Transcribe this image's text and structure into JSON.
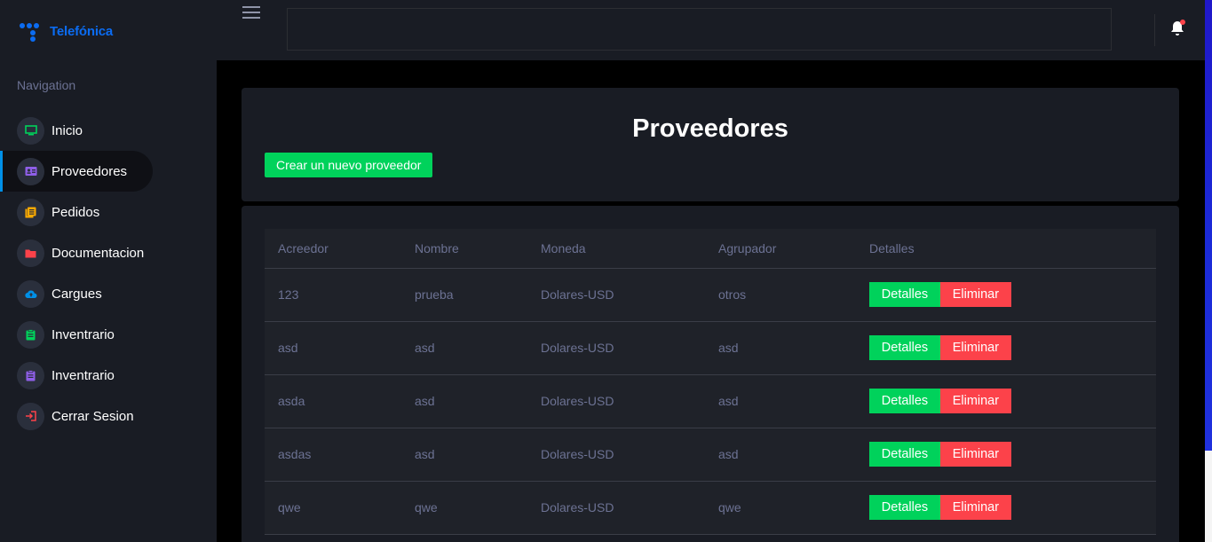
{
  "brand": {
    "name": "Telefónica",
    "color": "#0b6cf2"
  },
  "sidebar": {
    "caption": "Navigation",
    "items": [
      {
        "label": "Inicio",
        "icon": "monitor-icon",
        "color": "#00d25b"
      },
      {
        "label": "Proveedores",
        "icon": "id-card-icon",
        "color": "#8f5fe8",
        "active": true
      },
      {
        "label": "Pedidos",
        "icon": "documents-icon",
        "color": "#ffab00"
      },
      {
        "label": "Documentacion",
        "icon": "folder-icon",
        "color": "#fc424a"
      },
      {
        "label": "Cargues",
        "icon": "cloud-upload-icon",
        "color": "#0090e7"
      },
      {
        "label": "Inventrario",
        "icon": "clipboard-icon",
        "color": "#00d25b"
      },
      {
        "label": "Inventrario",
        "icon": "clipboard-icon",
        "color": "#8f5fe8"
      },
      {
        "label": "Cerrar Sesion",
        "icon": "logout-icon",
        "color": "#fc424a"
      }
    ]
  },
  "header": {
    "search_value": "",
    "notification_icon": "bell-icon"
  },
  "page": {
    "title": "Proveedores",
    "create_button": "Crear un nuevo proveedor"
  },
  "table": {
    "columns": [
      "Acreedor",
      "Nombre",
      "Moneda",
      "Agrupador",
      "Detalles"
    ],
    "rows": [
      {
        "acreedor": "123",
        "nombre": "prueba",
        "moneda": "Dolares-USD",
        "agrupador": "otros"
      },
      {
        "acreedor": "asd",
        "nombre": "asd",
        "moneda": "Dolares-USD",
        "agrupador": "asd"
      },
      {
        "acreedor": "asda",
        "nombre": "asd",
        "moneda": "Dolares-USD",
        "agrupador": "asd"
      },
      {
        "acreedor": "asdas",
        "nombre": "asd",
        "moneda": "Dolares-USD",
        "agrupador": "asd"
      },
      {
        "acreedor": "qwe",
        "nombre": "qwe",
        "moneda": "Dolares-USD",
        "agrupador": "qwe"
      }
    ],
    "details_button": "Detalles",
    "delete_button": "Eliminar"
  },
  "colors": {
    "success": "#00d25b",
    "danger": "#fc424a",
    "sidebar_bg": "#191c24",
    "muted_text": "#6c7293"
  }
}
